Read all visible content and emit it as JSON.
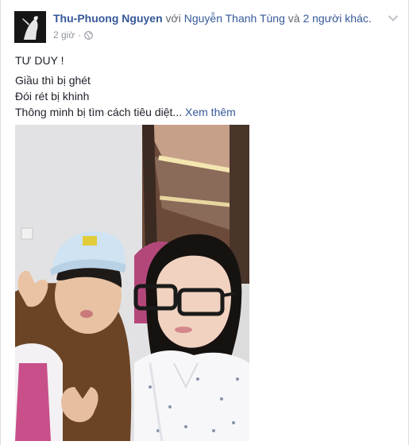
{
  "post": {
    "author": "Thu-Phuong Nguyen",
    "with_text": " với ",
    "tagged_user": "Nguyễn Thanh Tùng",
    "and_text": " và ",
    "others_text": "2 người khác.",
    "timestamp": "2 giờ",
    "separator": "·",
    "privacy_icon": "globe-icon",
    "menu_icon": "chevron-down-icon",
    "title": "TƯ DUY !",
    "lines": [
      "Giầu thì bị ghét",
      "Đói rét bị khinh",
      "Thông minh bị tìm cách tiêu diệt..."
    ],
    "see_more": "Xem thêm"
  },
  "colors": {
    "link": "#365899",
    "meta": "#90949c",
    "text": "#1d2129"
  }
}
